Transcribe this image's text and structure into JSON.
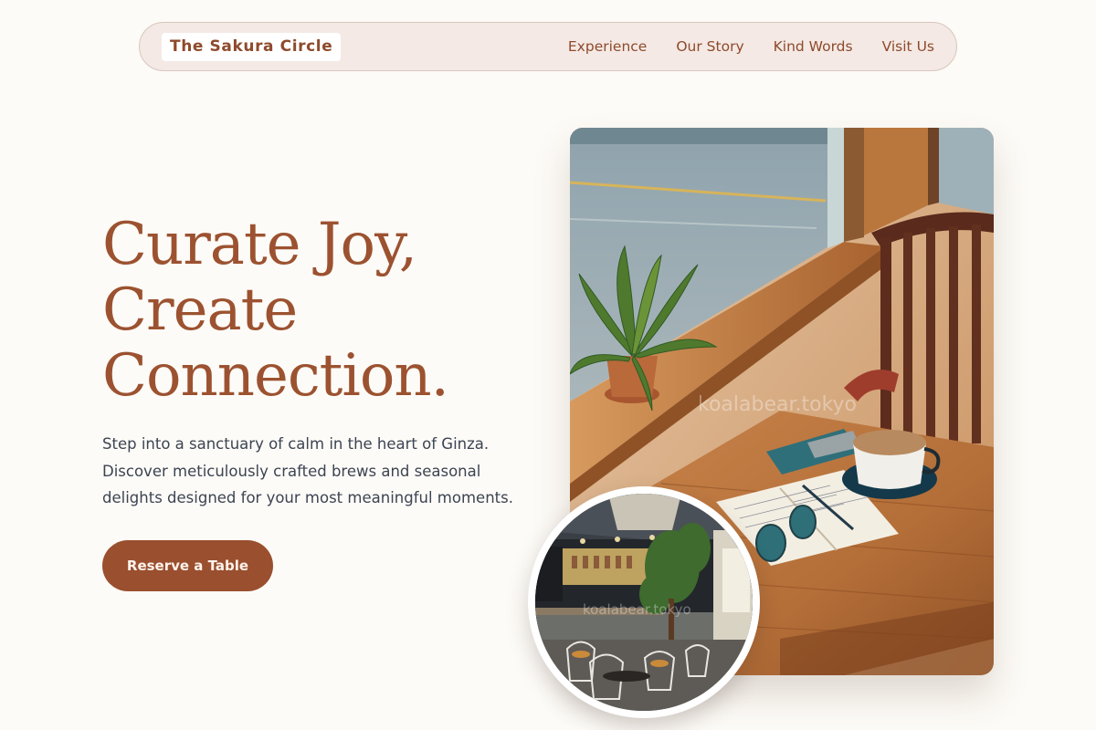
{
  "nav": {
    "brand": "The Sakura Circle",
    "links": [
      "Experience",
      "Our Story",
      "Kind Words",
      "Visit Us"
    ]
  },
  "hero": {
    "headline": [
      "Curate Joy,",
      "Create",
      "Connection."
    ],
    "lead": "Step into a sanctuary of calm in the heart of Ginza. Discover meticulously crafted brews and seasonal delights designed for your most meaningful moments.",
    "cta": "Reserve a Table"
  },
  "images": {
    "main_watermark": "koalabear.tokyo",
    "inset_watermark": "koalabear.tokyo"
  },
  "colors": {
    "brand": "#9a4f2e",
    "background": "#fdfbf7",
    "nav_bg": "#f4e9e4",
    "body_text": "#3c4452"
  }
}
